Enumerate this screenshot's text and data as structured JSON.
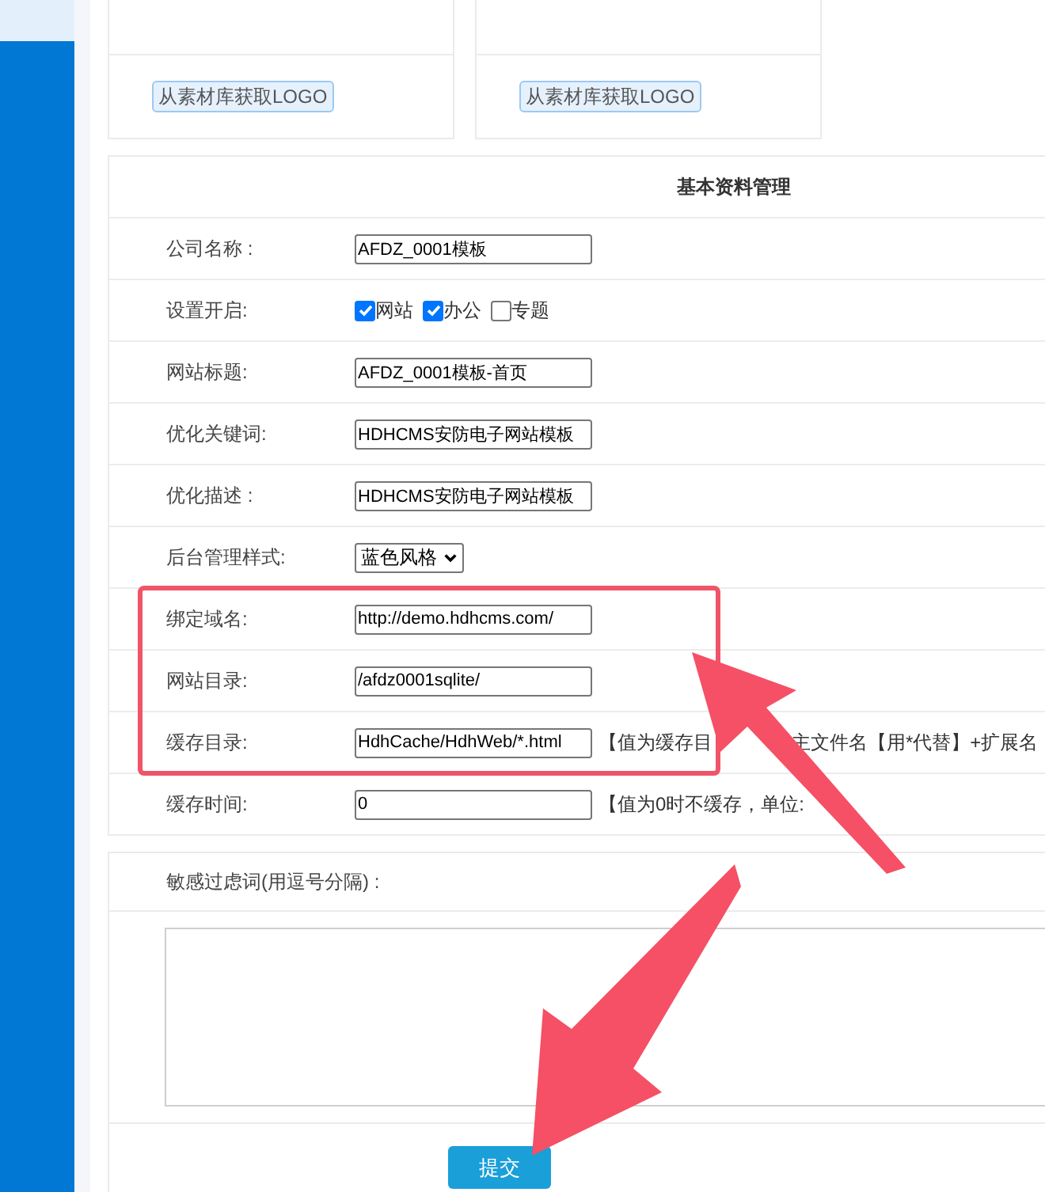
{
  "sidebar": {
    "items": [
      {
        "selected": true
      }
    ]
  },
  "logo_cards": [
    {
      "button": "从素材库获取LOGO"
    },
    {
      "button": "从素材库获取LOGO"
    }
  ],
  "basic_info": {
    "title": "基本资料管理",
    "rows": [
      {
        "kind": "text",
        "label": "公司名称 :",
        "value": "AFDZ_0001模板"
      },
      {
        "kind": "checkboxes",
        "label": "设置开启:",
        "options": [
          {
            "label": "网站",
            "checked": true
          },
          {
            "label": "办公",
            "checked": true
          },
          {
            "label": "专题",
            "checked": false
          }
        ]
      },
      {
        "kind": "text",
        "label": "网站标题:",
        "value": "AFDZ_0001模板-首页"
      },
      {
        "kind": "text",
        "label": "优化关键词:",
        "value": "HDHCMS安防电子网站模板"
      },
      {
        "kind": "text",
        "label": "优化描述 :",
        "value": "HDHCMS安防电子网站模板"
      },
      {
        "kind": "select",
        "label": "后台管理样式:",
        "value": "蓝色风格"
      },
      {
        "kind": "text",
        "label": "绑定域名:",
        "value": "http://demo.hdhcms.com/"
      },
      {
        "kind": "text",
        "label": "网站目录:",
        "value": "/afdz0001sqlite/"
      },
      {
        "kind": "text",
        "label": "缓存目录:",
        "value": "HdhCache/HdhWeb/*.html",
        "hints": [
          "【值为缓存目",
          "主文件名【用*代替】+扩展名"
        ]
      },
      {
        "kind": "text",
        "label": "缓存时间:",
        "value": "0",
        "hints": [
          "【值为0时不缓存，单位:"
        ]
      }
    ]
  },
  "filter_words": {
    "label": "敏感过虑词(用逗号分隔) :"
  },
  "submit": "提交"
}
